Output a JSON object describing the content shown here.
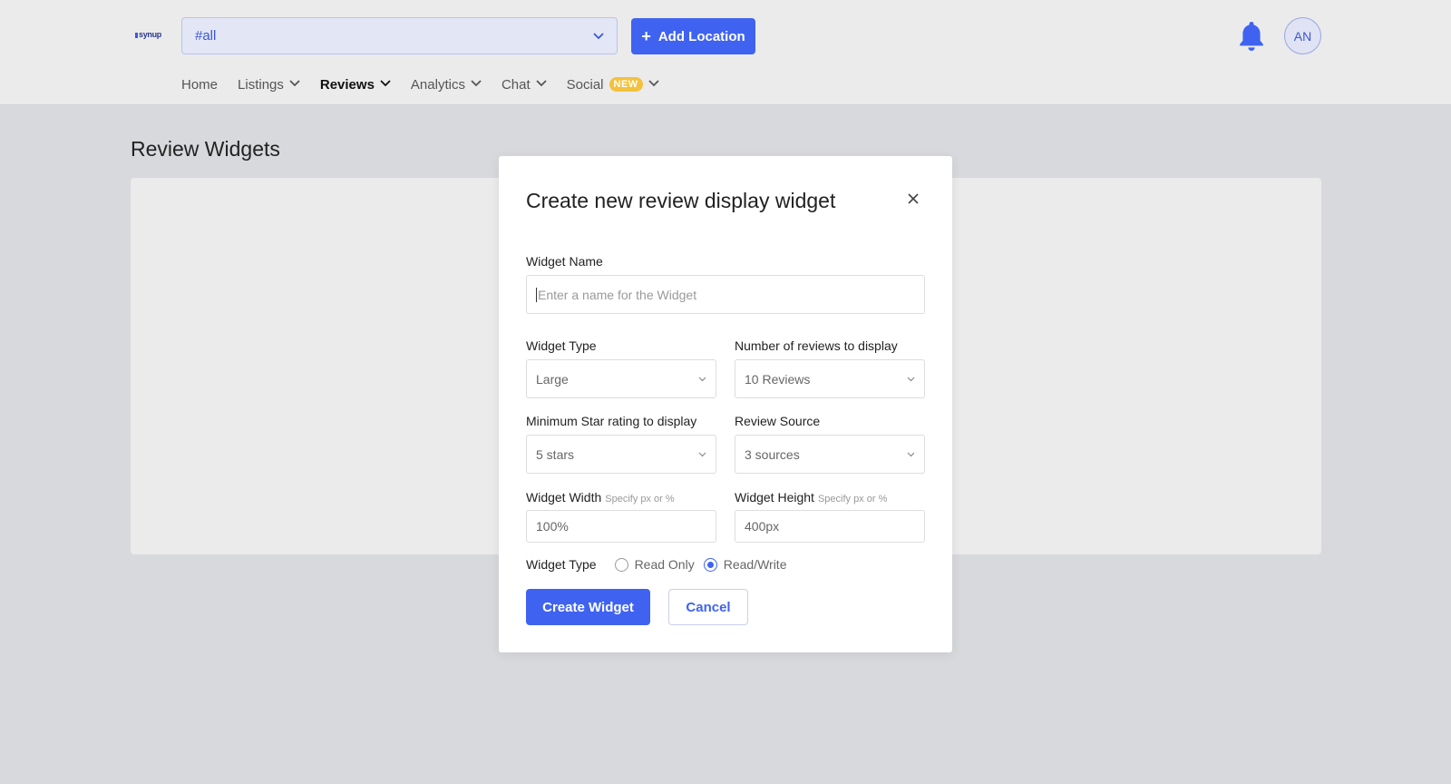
{
  "brand": {
    "logo_text": "synup",
    "accent": "#3f63f0"
  },
  "header": {
    "location_select": {
      "value": "#all"
    },
    "add_location_label": "Add Location",
    "avatar_initials": "AN"
  },
  "nav": {
    "home": "Home",
    "listings": "Listings",
    "reviews": "Reviews",
    "analytics": "Analytics",
    "chat": "Chat",
    "social": "Social",
    "social_badge": "NEW"
  },
  "page": {
    "title": "Review Widgets"
  },
  "modal": {
    "title": "Create new review display widget",
    "close_icon": "×",
    "widget_name": {
      "label": "Widget Name",
      "placeholder": "Enter a name for the Widget"
    },
    "widget_type_select": {
      "label": "Widget Type",
      "value": "Large"
    },
    "num_reviews": {
      "label": "Number of reviews to display",
      "value": "10 Reviews"
    },
    "min_star": {
      "label": "Minimum Star rating to display",
      "value": "5 stars"
    },
    "review_source": {
      "label": "Review Source",
      "value": "3 sources"
    },
    "widget_width": {
      "label": "Widget Width",
      "hint": "Specify px or %",
      "value": "100%"
    },
    "widget_height": {
      "label": "Widget Height",
      "hint": "Specify px or %",
      "value": "400px"
    },
    "access_type": {
      "label": "Widget Type",
      "options": [
        "Read Only",
        "Read/Write"
      ],
      "selected": "Read/Write"
    },
    "create_label": "Create Widget",
    "cancel_label": "Cancel"
  }
}
